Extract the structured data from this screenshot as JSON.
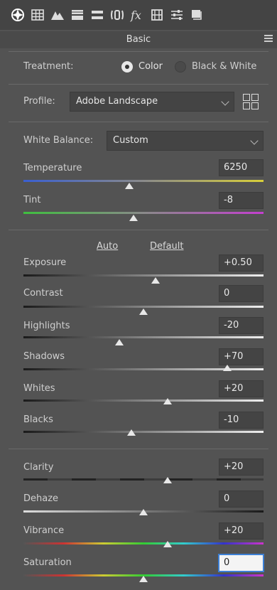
{
  "toolbar": {
    "icons": [
      "aperture-icon",
      "grid-icon",
      "mountain-icon",
      "hsl-icon",
      "split-tone-icon",
      "lens-icon",
      "fx-icon",
      "filmstrip-icon",
      "sliders-icon",
      "stack-icon"
    ]
  },
  "panel": {
    "title": "Basic"
  },
  "treatment": {
    "label": "Treatment:",
    "color_label": "Color",
    "bw_label": "Black & White",
    "selected": "Color"
  },
  "profile": {
    "label": "Profile:",
    "value": "Adobe Landscape"
  },
  "white_balance": {
    "label": "White Balance:",
    "value": "Custom"
  },
  "wb_sliders": [
    {
      "name": "temperature",
      "label": "Temperature",
      "value": "6250",
      "position": 0.44
    },
    {
      "name": "tint",
      "label": "Tint",
      "value": "-8",
      "position": 0.46
    }
  ],
  "links": {
    "auto": "Auto",
    "default": "Default"
  },
  "tone_sliders": [
    {
      "name": "exposure",
      "label": "Exposure",
      "value": "+0.50",
      "position": 0.55
    },
    {
      "name": "contrast",
      "label": "Contrast",
      "value": "0",
      "position": 0.5
    },
    {
      "name": "highlights",
      "label": "Highlights",
      "value": "-20",
      "position": 0.4
    },
    {
      "name": "shadows",
      "label": "Shadows",
      "value": "+70",
      "position": 0.85
    },
    {
      "name": "whites",
      "label": "Whites",
      "value": "+20",
      "position": 0.6
    },
    {
      "name": "blacks",
      "label": "Blacks",
      "value": "-10",
      "position": 0.45
    }
  ],
  "presence_sliders": [
    {
      "name": "clarity",
      "label": "Clarity",
      "value": "+20",
      "position": 0.6
    },
    {
      "name": "dehaze",
      "label": "Dehaze",
      "value": "0",
      "position": 0.5
    },
    {
      "name": "vibrance",
      "label": "Vibrance",
      "value": "+20",
      "position": 0.6
    },
    {
      "name": "saturation",
      "label": "Saturation",
      "value": "0",
      "position": 0.5
    }
  ],
  "colors": {
    "panel_bg": "#535353",
    "temperature_left": "#3a5fd0",
    "temperature_right": "#d8cf3a",
    "tint_left": "#3fbf3f",
    "tint_right": "#c43fd0"
  }
}
